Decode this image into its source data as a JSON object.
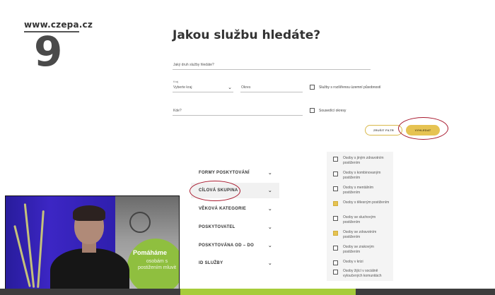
{
  "brand": {
    "url": "www.czepa.cz",
    "number": "9"
  },
  "form": {
    "title": "Jakou službu hledáte?",
    "service_type_label": "Jaký druh služby hledáte?",
    "region_label": "Kraj",
    "region_value": "Vyberte kraj",
    "district_label": "Okres",
    "extended_range_label": "Služby s rozšířenou územní působností",
    "where_label": "Kde?",
    "neighbor_districts_label": "Sousedící okresy",
    "reset_button": "ZRUŠIT FILTR",
    "search_button": "VYHLEDAT"
  },
  "filters": [
    {
      "label": "FORMY POSKYTOVÁNÍ",
      "active": false
    },
    {
      "label": "CÍLOVÁ SKUPINA",
      "active": true
    },
    {
      "label": "VĚKOVÁ KATEGORIE",
      "active": false
    },
    {
      "label": "POSKYTOVATEL",
      "active": false
    },
    {
      "label": "POSKYTOVÁNA OD – DO",
      "active": false
    },
    {
      "label": "ID SLUŽBY",
      "active": false
    }
  ],
  "target_groups": [
    {
      "label": "Osoby s jiným zdravotním postižením",
      "checked": false
    },
    {
      "label": "Osoby s kombinovaným postižením",
      "checked": false
    },
    {
      "label": "Osoby s mentálním postižením",
      "checked": false
    },
    {
      "label": "Osoby s tělesným postižením",
      "checked": true
    },
    {
      "label": "Osoby se sluchovým postižením",
      "checked": false
    },
    {
      "label": "Osoby se zdravotním postižením",
      "checked": true
    },
    {
      "label": "Osoby se zrakovým postižením",
      "checked": false
    },
    {
      "label": "Osoby v krizi",
      "checked": false
    },
    {
      "label": "Osoby žijící v sociálně vyloučených komunitách",
      "checked": false
    }
  ],
  "webcam": {
    "banner_title": "Pomáháme",
    "banner_text": "osobám s postižením mluvit"
  },
  "colors": {
    "accent_yellow": "#e6c352",
    "highlight_red": "#a8192e",
    "bottom_green": "#a6cc3a",
    "bottom_dark": "#3d3d3d"
  }
}
